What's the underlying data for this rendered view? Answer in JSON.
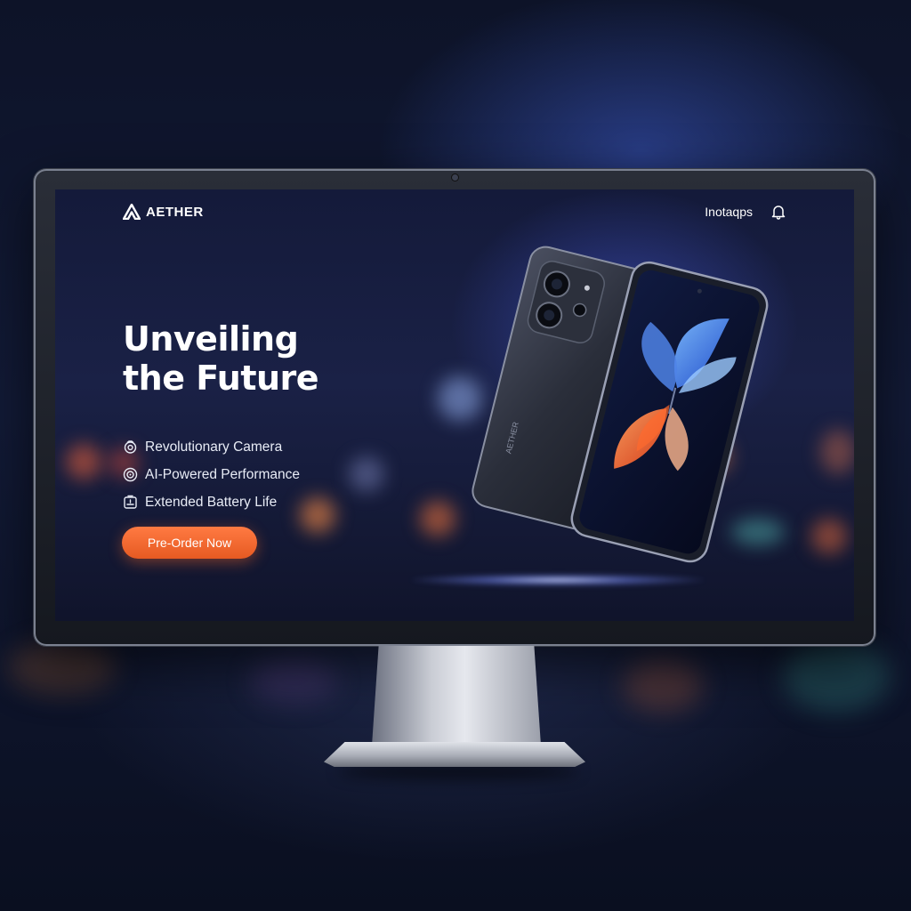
{
  "brand": {
    "name": "AETHER"
  },
  "nav": {
    "link_label": "Inotaqps"
  },
  "hero": {
    "title_line1": "Unveiling",
    "title_line2": "the Future"
  },
  "features": [
    {
      "label": "Revolutionary Camera",
      "icon": "camera-icon"
    },
    {
      "label": "AI-Powered Performance",
      "icon": "chip-icon"
    },
    {
      "label": "Extended Battery Life",
      "icon": "battery-icon"
    }
  ],
  "cta": {
    "label": "Pre-Order Now"
  },
  "phone": {
    "engraving": "AETHER"
  },
  "colors": {
    "accent": "#f26a32",
    "background": "#141a3a",
    "text": "#ffffff"
  }
}
